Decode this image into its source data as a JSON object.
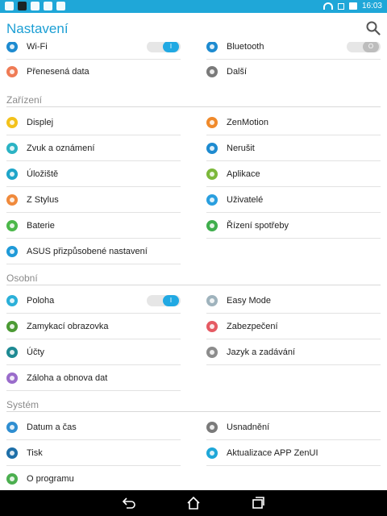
{
  "status": {
    "time": "16:03"
  },
  "appbar": {
    "title": "Nastavení"
  },
  "colors": {
    "accent": "#1c9fd4"
  },
  "wireless": {
    "top": [
      {
        "label": "Wi-Fi",
        "icon": "wifi-icon",
        "color": "#1e8bd0",
        "toggle": "on",
        "toggle_text": "I"
      },
      {
        "label": "Bluetooth",
        "icon": "bluetooth-icon",
        "color": "#1e8bd0",
        "toggle": "off",
        "toggle_text": "O"
      }
    ],
    "row2": [
      {
        "label": "Přenesená data",
        "icon": "data-usage-icon",
        "color": "#ef7b55"
      },
      {
        "label": "Další",
        "icon": "more-icon",
        "color": "#7a7a7a"
      }
    ]
  },
  "device": {
    "header": "Zařízení",
    "left": [
      {
        "label": "Displej",
        "icon": "display-icon",
        "color": "#f3c21b"
      },
      {
        "label": "Zvuk a oznámení",
        "icon": "sound-icon",
        "color": "#2bb3c4"
      },
      {
        "label": "Úložiště",
        "icon": "storage-icon",
        "color": "#1ea5c9"
      },
      {
        "label": "Z Stylus",
        "icon": "stylus-icon",
        "color": "#f08a3c"
      },
      {
        "label": "Baterie",
        "icon": "battery-icon",
        "color": "#4cb84a"
      },
      {
        "label": "ASUS přizpůsobené nastavení",
        "icon": "asus-custom-icon",
        "color": "#1f9ad8"
      }
    ],
    "right": [
      {
        "label": "ZenMotion",
        "icon": "zenmotion-icon",
        "color": "#f08a2b"
      },
      {
        "label": "Nerušit",
        "icon": "do-not-disturb-icon",
        "color": "#1e8bd0"
      },
      {
        "label": "Aplikace",
        "icon": "apps-icon",
        "color": "#7cb83a"
      },
      {
        "label": "Uživatelé",
        "icon": "users-icon",
        "color": "#2a9fdf"
      },
      {
        "label": "Řízení spotřeby",
        "icon": "power-icon",
        "color": "#3fae4d"
      }
    ]
  },
  "personal": {
    "header": "Osobní",
    "left": [
      {
        "label": "Poloha",
        "icon": "location-icon",
        "color": "#2bb0d9",
        "toggle": "on",
        "toggle_text": "I"
      },
      {
        "label": "Zamykací obrazovka",
        "icon": "lockscreen-icon",
        "color": "#4b9a34"
      },
      {
        "label": "Účty",
        "icon": "accounts-icon",
        "color": "#1e8a93"
      },
      {
        "label": "Záloha a obnova dat",
        "icon": "backup-icon",
        "color": "#9a6ccb"
      }
    ],
    "right": [
      {
        "label": "Easy Mode",
        "icon": "easy-mode-icon",
        "color": "#9fb3bd"
      },
      {
        "label": "Zabezpečení",
        "icon": "security-icon",
        "color": "#e55a63"
      },
      {
        "label": "Jazyk a zadávání",
        "icon": "language-icon",
        "color": "#8c8c8c"
      }
    ]
  },
  "system": {
    "header": "Systém",
    "left": [
      {
        "label": "Datum a čas",
        "icon": "clock-icon",
        "color": "#2f8ed1"
      },
      {
        "label": "Tisk",
        "icon": "print-icon",
        "color": "#1e6fa8"
      },
      {
        "label": "O programu",
        "icon": "about-icon",
        "color": "#4caf50"
      }
    ],
    "right": [
      {
        "label": "Usnadnění",
        "icon": "accessibility-icon",
        "color": "#7a7a7a"
      },
      {
        "label": "Aktualizace APP ZenUI",
        "icon": "update-icon",
        "color": "#1fa7d8"
      }
    ]
  }
}
